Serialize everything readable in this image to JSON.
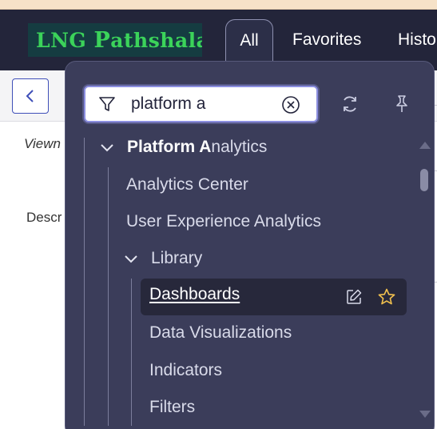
{
  "app": {
    "logo_text_prefix": "LNG ",
    "logo_text_big": "P",
    "logo_text_suffix": "athshala",
    "tabs": [
      {
        "label": "All",
        "active": true
      },
      {
        "label": "Favorites",
        "active": false
      },
      {
        "label": "History",
        "active": false
      }
    ]
  },
  "background": {
    "view_label": "Viewn",
    "description_label": "Descr"
  },
  "filter": {
    "value": "platform a",
    "placeholder": "Filter"
  },
  "tree": {
    "root": {
      "label_match": "Platform A",
      "label_rest": "nalytics",
      "expanded": true
    },
    "items": [
      {
        "label": "Analytics Center"
      },
      {
        "label": "User Experience Analytics"
      },
      {
        "label": "Library",
        "expanded": true
      }
    ],
    "library_children": [
      {
        "label": "Dashboards",
        "selected": true
      },
      {
        "label": "Data Visualizations"
      },
      {
        "label": "Indicators"
      },
      {
        "label": "Filters"
      }
    ]
  },
  "colors": {
    "header_bg": "#23253a",
    "panel_bg": "#3b3d5a",
    "selected_row_bg": "#27283b",
    "accent": "#8c8fe0",
    "logo_text": "#3bd35a",
    "star": "#f2c14e"
  }
}
